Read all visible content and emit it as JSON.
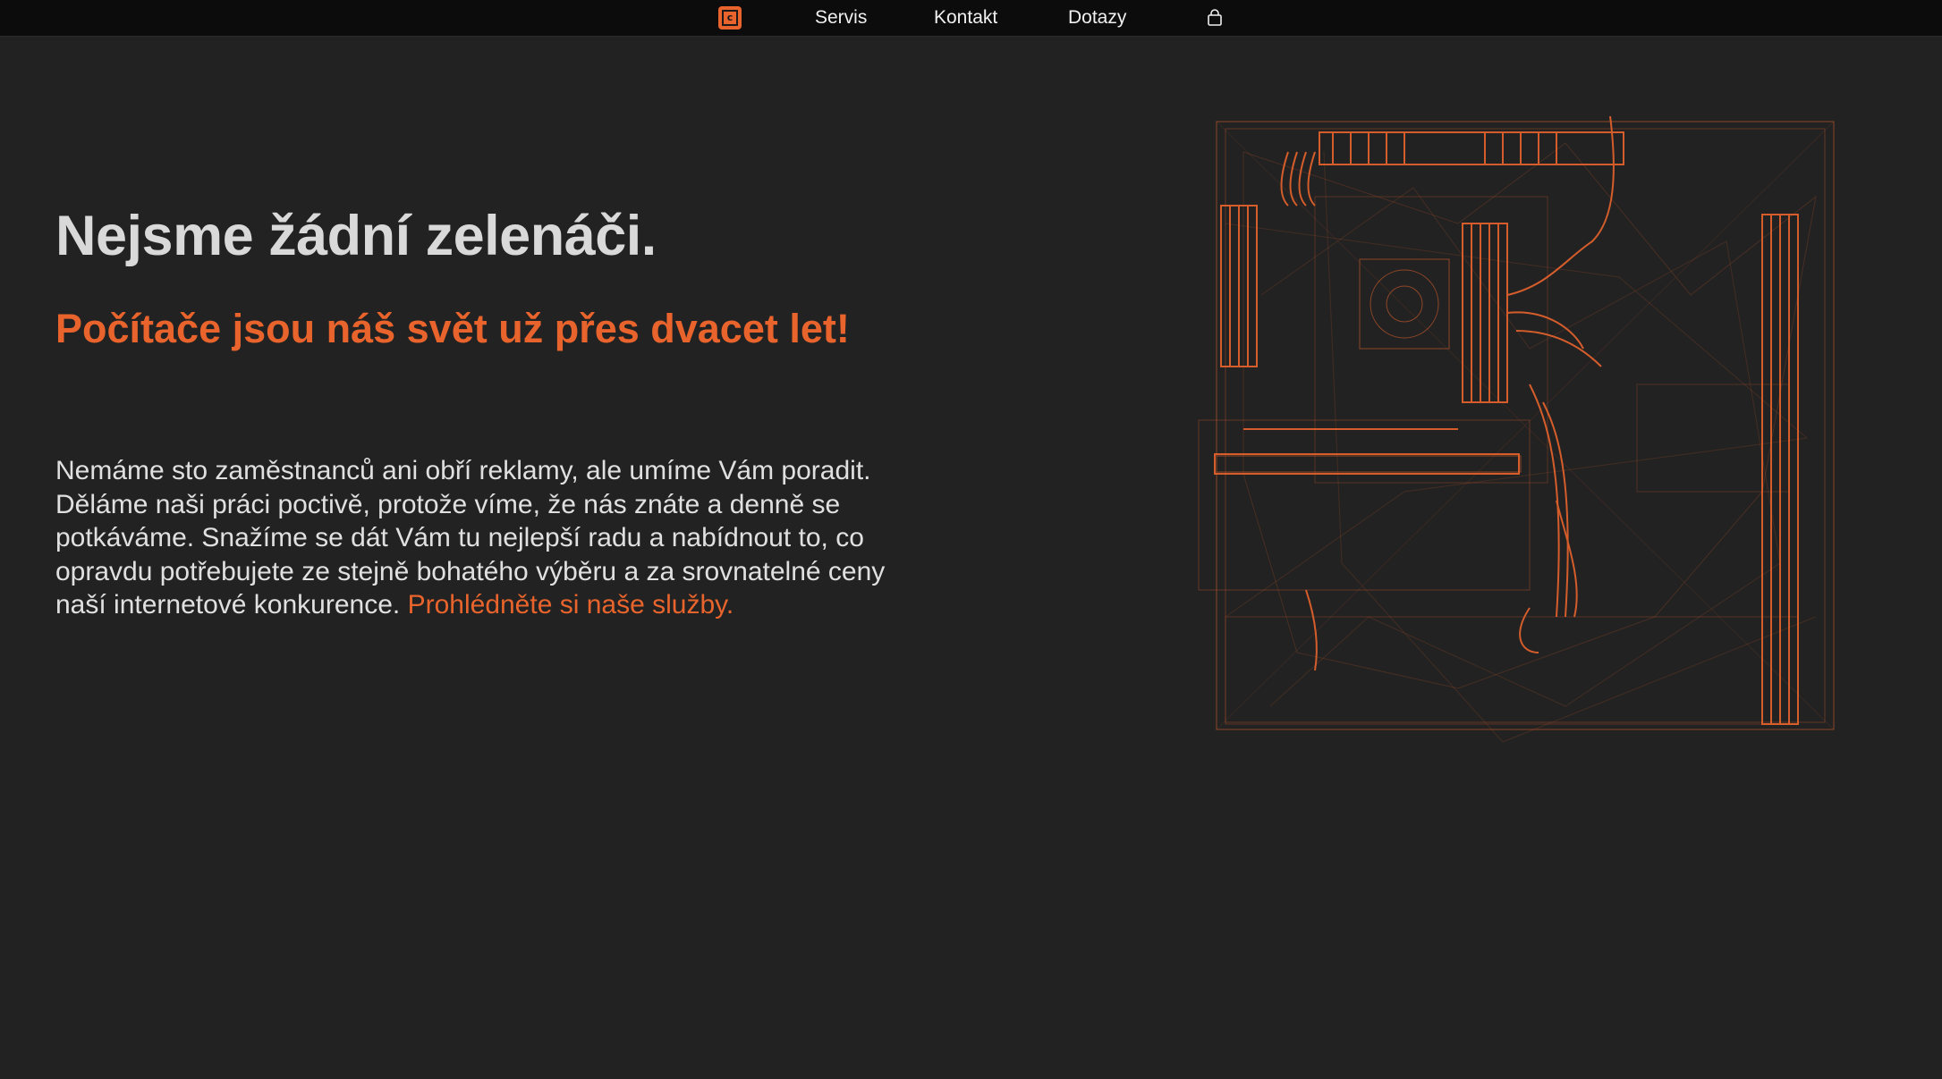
{
  "nav": {
    "logo_icon": "computer-logo-icon",
    "items": [
      {
        "label": "Servis"
      },
      {
        "label": "Kontakt"
      },
      {
        "label": "Dotazy"
      }
    ],
    "bag_icon": "shopping-bag-icon"
  },
  "hero": {
    "title": "Nejsme žádní zelenáči.",
    "subtitle": "Počítače jsou náš svět už přes dvacet let!",
    "body": "Nemáme sto zaměstnanců ani obří reklamy, ale umíme Vám poradit. Děláme naši práci poctivě, protože víme, že nás znáte a denně se potkáváme. Snažíme se dát Vám tu nejlepší radu a nabídnout to, co opravdu potřebujete ze stejně bohatého výběru a za srovnatelné ceny naší internetové konkurence.",
    "link": "Prohlédněte si naše služby."
  },
  "colors": {
    "accent": "#e8642c",
    "background": "#222222",
    "navbar": "#0c0c0c",
    "heading": "#d9d9d9"
  }
}
